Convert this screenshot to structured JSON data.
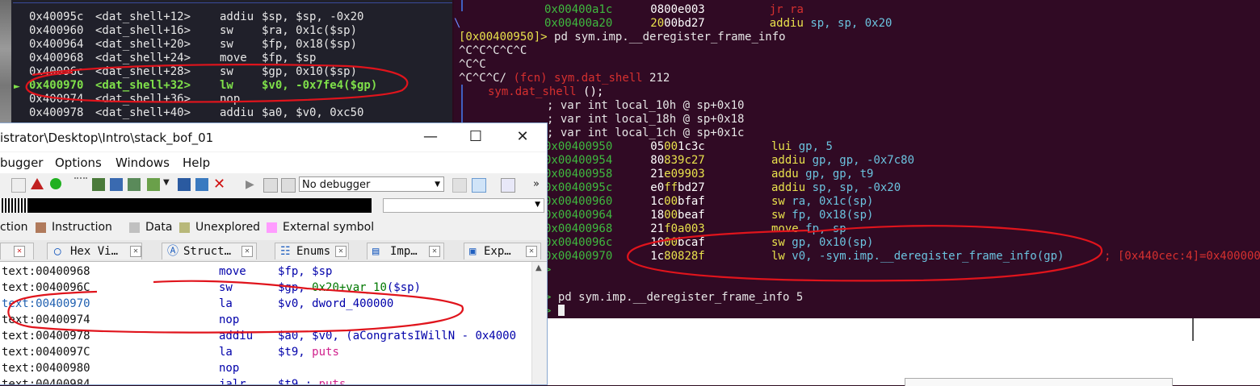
{
  "gdb": {
    "rows": [
      {
        "addr": "0x40095c",
        "sym": "<dat_shell+12>",
        "mn": "addiu",
        "ops": "$sp, $sp, -0x20"
      },
      {
        "addr": "0x400960",
        "sym": "<dat_shell+16>",
        "mn": "sw",
        "ops": "$ra, 0x1c($sp)"
      },
      {
        "addr": "0x400964",
        "sym": "<dat_shell+20>",
        "mn": "sw",
        "ops": "$fp, 0x18($sp)"
      },
      {
        "addr": "0x400968",
        "sym": "<dat_shell+24>",
        "mn": "move",
        "ops": "$fp, $sp"
      },
      {
        "addr": "0x40096c",
        "sym": "<dat_shell+28>",
        "mn": "sw",
        "ops": "$gp, 0x10($sp)"
      },
      {
        "addr": "0x400970",
        "sym": "<dat_shell+32>",
        "mn": "lw",
        "ops": "$v0, -0x7fe4($gp)"
      },
      {
        "addr": "0x400974",
        "sym": "<dat_shell+36>",
        "mn": "nop",
        "ops": ""
      },
      {
        "addr": "0x400978",
        "sym": "<dat_shell+40>",
        "mn": "addiu",
        "ops": "$a0, $v0, 0xc50"
      }
    ],
    "current_marker": "►"
  },
  "terminal": {
    "top_rows": [
      {
        "addr": "0x00400a1c",
        "b1": "08",
        "b2": "00e003",
        "ins": "jr ra",
        "ops": ""
      },
      {
        "addr": "0x00400a20",
        "b1": "20",
        "b2": "00bd27",
        "ins": "addiu",
        "ops": "sp, sp, 0x20"
      }
    ],
    "prompt": "[0x00400950]>",
    "cmd1": "pd sym.imp.__deregister_frame_info",
    "ctrl1": "^C^C^C^C^C",
    "ctrl2": "^C^C",
    "ctrl3": "^C^C^C/",
    "fcn": "(fcn) sym.dat_shell",
    "fcn_size": "212",
    "sig_name": "sym.dat_shell",
    "sig_rest": "();",
    "vars": [
      "; var int local_10h @ sp+0x10",
      "; var int local_18h @ sp+0x18",
      "; var int local_1ch @ sp+0x1c"
    ],
    "dis": [
      {
        "addr": "0x00400950",
        "b1": "05",
        "b2": "00",
        "b3": "1c3c",
        "mn": "lui",
        "ops": "gp, 5"
      },
      {
        "addr": "0x00400954",
        "b1": "80",
        "b2": "839c27",
        "b3": "",
        "mn": "addiu",
        "ops": "gp, gp, -0x7c80"
      },
      {
        "addr": "0x00400958",
        "b1": "21",
        "b2": "e09903",
        "b3": "",
        "mn": "addu",
        "ops": "gp, gp, t9"
      },
      {
        "addr": "0x0040095c",
        "b1": "e0",
        "b2": "ff",
        "b3": "bd27",
        "mn": "addiu",
        "ops": "sp, sp, -0x20"
      },
      {
        "addr": "0x00400960",
        "b1": "1c",
        "b2": "00",
        "b3": "bfaf",
        "mn": "sw",
        "ops": "ra, 0x1c(sp)"
      },
      {
        "addr": "0x00400964",
        "b1": "18",
        "b2": "00",
        "b3": "beaf",
        "mn": "sw",
        "ops": "fp, 0x18(sp)"
      },
      {
        "addr": "0x00400968",
        "b1": "21",
        "b2": "f0a003",
        "b3": "",
        "mn": "move",
        "ops": "fp, sp"
      },
      {
        "addr": "0x0040096c",
        "b1": "10",
        "b2": "00",
        "b3": "bcaf",
        "mn": "sw",
        "ops": "gp, 0x10(sp)"
      },
      {
        "addr": "0x00400970",
        "b1": "1c",
        "b2": "80828f",
        "b3": "",
        "mn": "lw",
        "ops": "v0, -sym.imp.__deregister_frame_info(gp)"
      }
    ],
    "dis_comment": "; [0x440cec:4]=0x400000",
    "cmd2": "pd sym.imp.__deregister_frame_info 5",
    "small_prompt": ">"
  },
  "ida": {
    "title": "istrator\\Desktop\\Intro\\stack_bof_01",
    "menus": [
      "bugger",
      "Options",
      "Windows",
      "Help"
    ],
    "debugger_select": "No debugger",
    "legend": [
      {
        "label": "ction",
        "color": ""
      },
      {
        "label": "Instruction",
        "color": "#b07a5c"
      },
      {
        "label": "Data",
        "color": "#c0c0c0"
      },
      {
        "label": "Unexplored",
        "color": "#b8b87a"
      },
      {
        "label": "External symbol",
        "color": "#ff9cff"
      }
    ],
    "tabs": [
      "Hex Vi…",
      "Struct…",
      "Enums",
      "Imp…",
      "Exp…"
    ],
    "code": [
      {
        "addr": "text:00400968",
        "mn": "move",
        "ops": "$fp, $sp"
      },
      {
        "addr": "text:0040096C",
        "mn": "sw",
        "ops": "$gp, ",
        "ops2": "0x20+var_10",
        "ops3": "($sp)"
      },
      {
        "addr": "text:00400970",
        "mn": "la",
        "ops": "$v0, ",
        "ops2": "dword_400000",
        "ops3": ""
      },
      {
        "addr": "text:00400974",
        "mn": "nop",
        "ops": ""
      },
      {
        "addr": "text:00400978",
        "mn": "addiu",
        "ops": "$a0, $v0, ",
        "ops2": "(aCongratsIWillN - 0x4000",
        "ops3": ""
      },
      {
        "addr": "text:0040097C",
        "mn": "la",
        "ops": "$t9, ",
        "ops2": "puts",
        "ops3": ""
      },
      {
        "addr": "text:00400980",
        "mn": "nop",
        "ops": ""
      },
      {
        "addr": "text:00400984",
        "mn": "jalr",
        "ops": "$t9 ; ",
        "ops2": "puts",
        "ops3": ""
      }
    ]
  },
  "colors": {
    "terminal_bg": "#300a24",
    "gdb_bg": "#20202a",
    "annotation": "#e0141c",
    "current_line": "#7fe04a"
  }
}
